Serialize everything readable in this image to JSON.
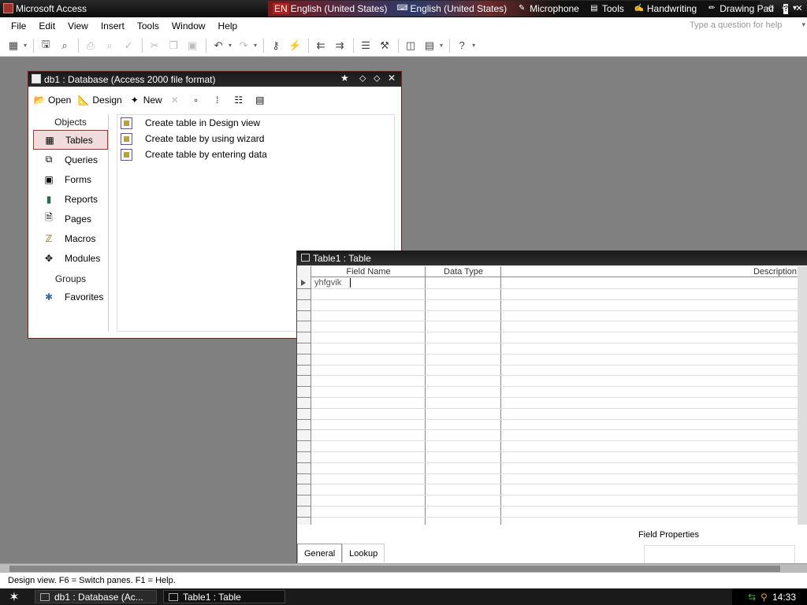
{
  "app": {
    "title": "Microsoft Access",
    "window_controls": [
      "minimize",
      "restore",
      "close"
    ]
  },
  "langbar": {
    "lang_code": "EN",
    "lang_name": "English (United States)",
    "keyboard": "English (United States)",
    "microphone": "Microphone",
    "tools": "Tools",
    "handwriting": "Handwriting",
    "drawing_pad": "Drawing Pad",
    "help": "?"
  },
  "menu": {
    "items": [
      {
        "label": "File"
      },
      {
        "label": "Edit"
      },
      {
        "label": "View"
      },
      {
        "label": "Insert"
      },
      {
        "label": "Tools"
      },
      {
        "label": "Window"
      },
      {
        "label": "Help"
      }
    ],
    "ask_placeholder": "Type a question for help"
  },
  "db_window": {
    "title": "db1 : Database (Access 2000 file format)",
    "toolbar": {
      "open": "Open",
      "design": "Design",
      "new": "New"
    },
    "objects_header": "Objects",
    "objects": [
      {
        "label": "Tables",
        "icon": "table-icon",
        "selected": true
      },
      {
        "label": "Queries",
        "icon": "query-icon"
      },
      {
        "label": "Forms",
        "icon": "form-icon"
      },
      {
        "label": "Reports",
        "icon": "report-icon"
      },
      {
        "label": "Pages",
        "icon": "page-icon"
      },
      {
        "label": "Macros",
        "icon": "macro-icon"
      },
      {
        "label": "Modules",
        "icon": "module-icon"
      }
    ],
    "groups_header": "Groups",
    "groups": [
      {
        "label": "Favorites",
        "icon": "favorites-icon"
      }
    ],
    "list_items": [
      {
        "label": "Create table in Design view"
      },
      {
        "label": "Create table by using wizard"
      },
      {
        "label": "Create table by entering data"
      }
    ]
  },
  "table_window": {
    "title": "Table1 : Table",
    "columns": {
      "field_name": "Field Name",
      "data_type": "Data Type",
      "description": "Description"
    },
    "current_field_name": "yhfgvik",
    "field_properties_label": "Field Properties",
    "tabs": [
      {
        "label": "General",
        "active": true
      },
      {
        "label": "Lookup",
        "active": false
      }
    ]
  },
  "status_bar": {
    "text": "Design view.  F6 = Switch panes.  F1 = Help."
  },
  "taskbar": {
    "tasks": [
      {
        "label": "db1 : Database (Ac..."
      },
      {
        "label": "Table1 : Table",
        "active": true
      }
    ],
    "clock": "14:33"
  },
  "colors": {
    "accent_red": "#b03030",
    "title_bar": "#1a1a1a"
  }
}
